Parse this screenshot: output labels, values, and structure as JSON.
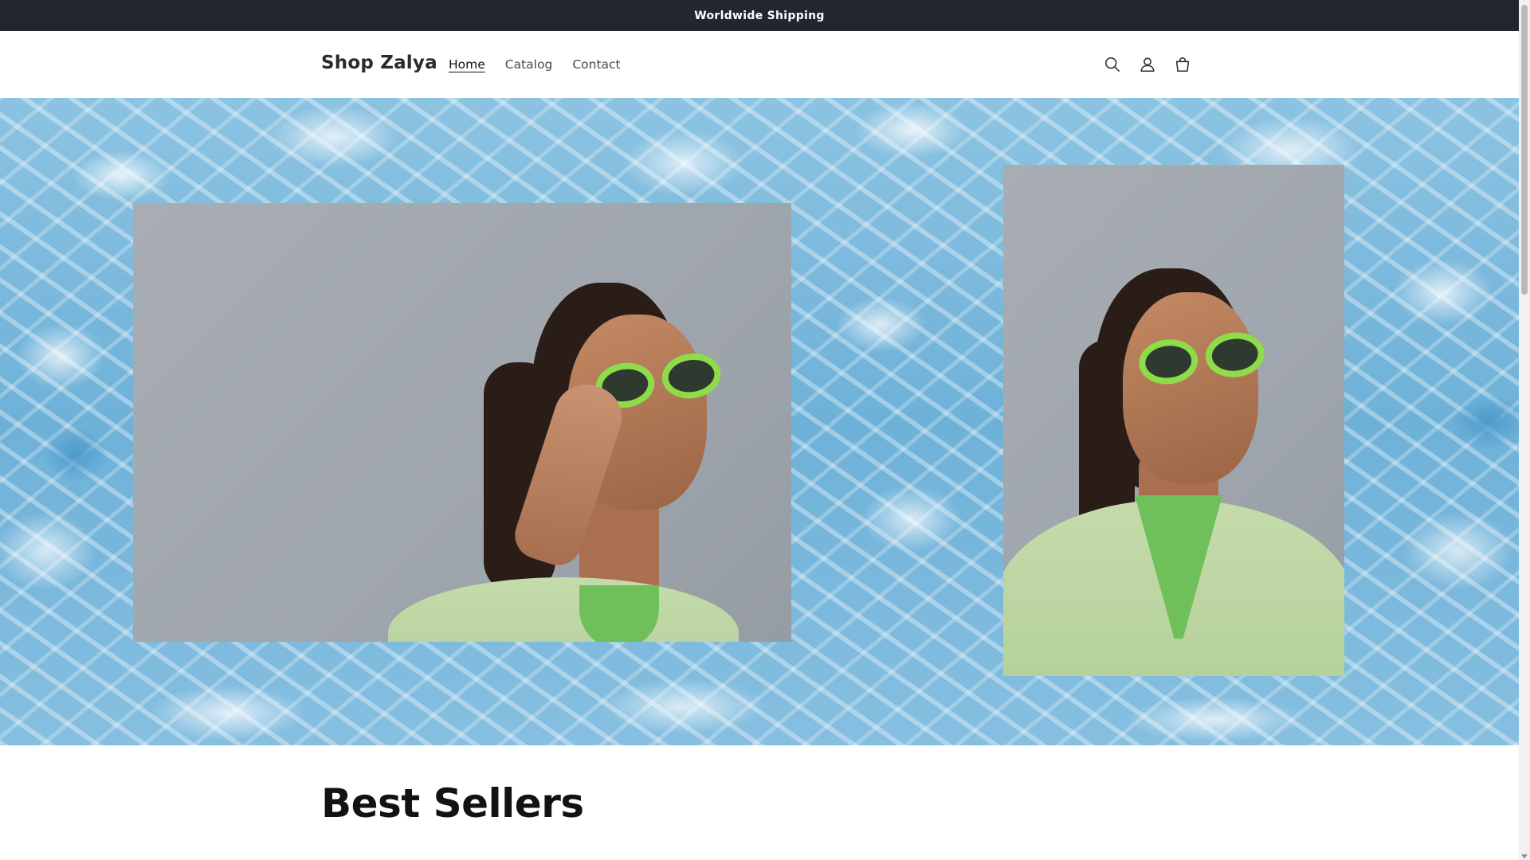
{
  "announcement": {
    "text": "Worldwide Shipping"
  },
  "header": {
    "logo": "Shop Zalya",
    "nav": [
      {
        "label": "Home",
        "active": true
      },
      {
        "label": "Catalog",
        "active": false
      },
      {
        "label": "Contact",
        "active": false
      }
    ],
    "icons": [
      "search-icon",
      "account-icon",
      "cart-icon"
    ]
  },
  "hero": {
    "background": "pool-water",
    "images": [
      "model-green-sunglasses-hand",
      "model-green-sunglasses-jacket"
    ],
    "colors": {
      "water": "#6eb1d8",
      "glasses": "#8fdc4a",
      "jacket": "#c5dbab"
    }
  },
  "featured": {
    "title": "Best Sellers"
  },
  "colors": {
    "announcement_bg": "#23262f",
    "text": "#121212"
  }
}
